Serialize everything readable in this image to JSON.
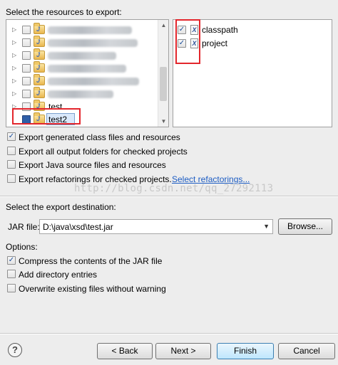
{
  "resources": {
    "heading": "Select the resources to export:",
    "tree_items": [
      {
        "label": "",
        "blurred": true,
        "expandable": true,
        "checked": false
      },
      {
        "label": "",
        "blurred": true,
        "expandable": true,
        "checked": false
      },
      {
        "label": "",
        "blurred": true,
        "expandable": true,
        "checked": false
      },
      {
        "label": "",
        "blurred": true,
        "expandable": true,
        "checked": false
      },
      {
        "label": "",
        "blurred": true,
        "expandable": true,
        "checked": false
      },
      {
        "label": "",
        "blurred": true,
        "expandable": true,
        "checked": false
      },
      {
        "label": "test",
        "blurred": false,
        "expandable": true,
        "checked": false
      },
      {
        "label": "test2",
        "blurred": false,
        "expandable": false,
        "checked": true,
        "selected": true
      }
    ],
    "classpath_items": [
      {
        "label": "classpath",
        "checked": true
      },
      {
        "label": "project",
        "checked": true
      }
    ]
  },
  "export_options": {
    "generated_class_files": {
      "label": "Export generated class files and resources",
      "checked": true
    },
    "output_folders": {
      "label": "Export all output folders for checked projects",
      "checked": false
    },
    "java_source": {
      "label": "Export Java source files and resources",
      "checked": false
    },
    "refactorings": {
      "label": "Export refactorings for checked projects.",
      "checked": false
    },
    "select_refactorings_link": "Select refactorings..."
  },
  "watermark": "http://blog.csdn.net/qq_27292113",
  "destination": {
    "heading": "Select the export destination:",
    "jar_label": "JAR file:",
    "jar_value": "D:\\java\\xsd\\test.jar",
    "browse_label": "Browse..."
  },
  "options": {
    "heading": "Options:",
    "compress": {
      "label": "Compress the contents of the JAR file",
      "checked": true
    },
    "directory_entries": {
      "label": "Add directory entries",
      "checked": false
    },
    "overwrite": {
      "label": "Overwrite existing files without warning",
      "checked": false
    }
  },
  "footer": {
    "help_icon": "?",
    "back_label": "< Back",
    "next_label": "Next >",
    "finish_label": "Finish",
    "cancel_label": "Cancel"
  },
  "colors": {
    "highlight": "#e3262c",
    "link": "#1c5cc3",
    "check": "#1a4d9a"
  }
}
